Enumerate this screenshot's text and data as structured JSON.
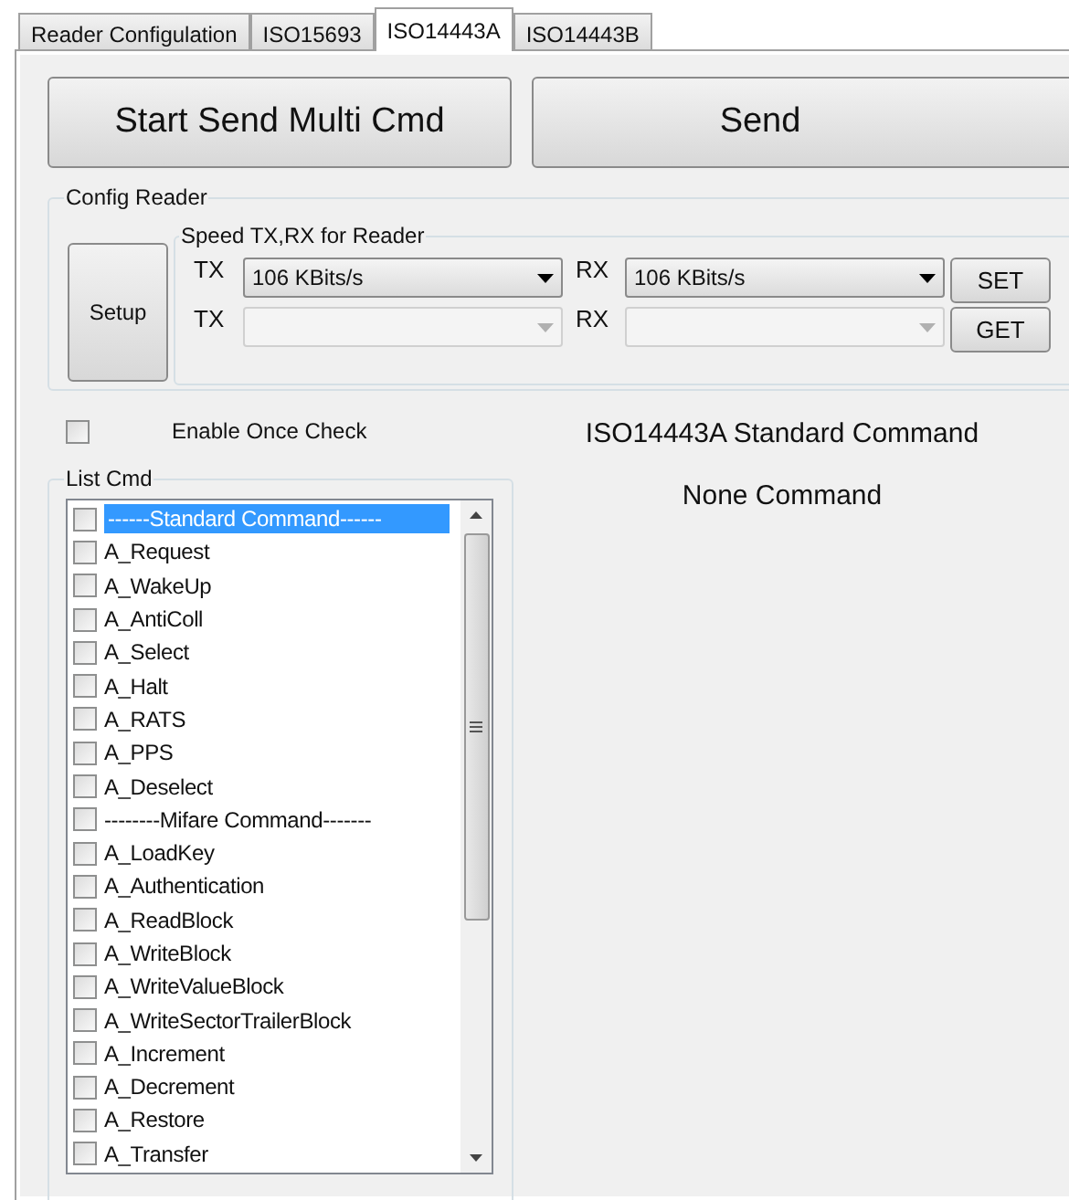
{
  "tabs": [
    {
      "label": "Reader Configulation",
      "selected": false
    },
    {
      "label": "ISO15693",
      "selected": false
    },
    {
      "label": "ISO14443A",
      "selected": true
    },
    {
      "label": "ISO14443B",
      "selected": false
    }
  ],
  "buttons": [
    "Start Send Multi Cmd",
    "Send"
  ],
  "config_reader": {
    "title": "Config Reader",
    "setup": "Setup",
    "speed": {
      "title": "Speed TX,RX for Reader",
      "rows": [
        {
          "tx": {
            "label": "TX",
            "value": "106 KBits/s",
            "disabled": false
          },
          "rx": {
            "label": "RX",
            "value": "106 KBits/s",
            "disabled": false
          },
          "button": "SET"
        },
        {
          "tx": {
            "label": "TX",
            "disabled": true
          },
          "rx": {
            "label": "RX",
            "disabled": true
          },
          "button": "GET"
        }
      ]
    }
  },
  "enable_once_check": {
    "label": "Enable Once Check",
    "checked": false
  },
  "status": [
    "ISO14443A Standard Command",
    "None Command"
  ],
  "list_cmd": {
    "title": "List Cmd",
    "items": [
      {
        "label": "------Standard Command------",
        "checked": false,
        "selected": true
      },
      {
        "label": "A_Request",
        "checked": false,
        "selected": false
      },
      {
        "label": "A_WakeUp",
        "checked": false,
        "selected": false
      },
      {
        "label": "A_AntiColl",
        "checked": false,
        "selected": false
      },
      {
        "label": "A_Select",
        "checked": false,
        "selected": false
      },
      {
        "label": "A_Halt",
        "checked": false,
        "selected": false
      },
      {
        "label": "A_RATS",
        "checked": false,
        "selected": false
      },
      {
        "label": "A_PPS",
        "checked": false,
        "selected": false
      },
      {
        "label": "A_Deselect",
        "checked": false,
        "selected": false
      },
      {
        "label": "--------Mifare Command-------",
        "checked": false,
        "selected": false
      },
      {
        "label": "A_LoadKey",
        "checked": false,
        "selected": false
      },
      {
        "label": "A_Authentication",
        "checked": false,
        "selected": false
      },
      {
        "label": "A_ReadBlock",
        "checked": false,
        "selected": false
      },
      {
        "label": "A_WriteBlock",
        "checked": false,
        "selected": false
      },
      {
        "label": "A_WriteValueBlock",
        "checked": false,
        "selected": false
      },
      {
        "label": "A_WriteSectorTrailerBlock",
        "checked": false,
        "selected": false
      },
      {
        "label": "A_Increment",
        "checked": false,
        "selected": false
      },
      {
        "label": "A_Decrement",
        "checked": false,
        "selected": false
      },
      {
        "label": "A_Restore",
        "checked": false,
        "selected": false
      },
      {
        "label": "A_Transfer",
        "checked": false,
        "selected": false
      }
    ]
  }
}
